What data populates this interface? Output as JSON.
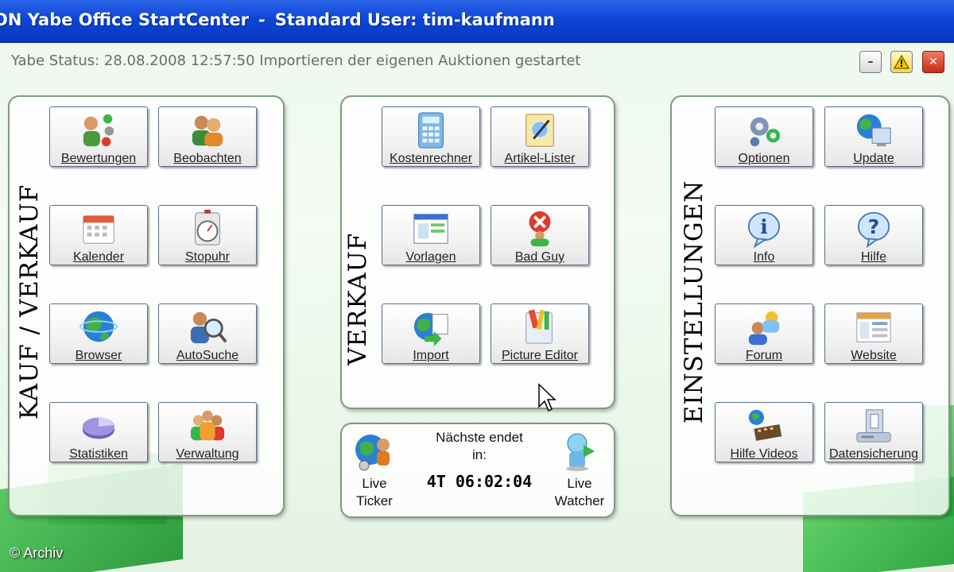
{
  "window": {
    "title_app": "ON Yabe Office StartCenter",
    "title_separator": "-",
    "title_user": "Standard User: tim-kaufmann",
    "status": "Yabe Status: 28.08.2008 12:57:50 Importieren der eigenen Auktionen gestartet",
    "buttons": {
      "minimize": "–",
      "warning": "!",
      "close": "✕"
    }
  },
  "panels": {
    "kauf": {
      "title": "KAUF / VERKAUF",
      "tiles": [
        {
          "label": "Bewertungen",
          "icon": "users-rating-icon"
        },
        {
          "label": "Beobachten",
          "icon": "watch-users-icon"
        },
        {
          "label": "Kalender",
          "icon": "calendar-icon"
        },
        {
          "label": "Stopuhr",
          "icon": "stopwatch-icon"
        },
        {
          "label": "Browser",
          "icon": "globe-icon"
        },
        {
          "label": "AutoSuche",
          "icon": "user-search-icon"
        },
        {
          "label": "Statistiken",
          "icon": "pie-chart-icon"
        },
        {
          "label": "Verwaltung",
          "icon": "group-icon"
        }
      ]
    },
    "verkauf": {
      "title": "VERKAUF",
      "tiles": [
        {
          "label": "Kostenrechner",
          "icon": "calculator-icon"
        },
        {
          "label": "Artikel-Lister",
          "icon": "article-list-icon"
        },
        {
          "label": "Vorlagen",
          "icon": "template-icon"
        },
        {
          "label": "Bad Guy",
          "icon": "bad-user-icon"
        },
        {
          "label": "Import",
          "icon": "import-icon"
        },
        {
          "label": "Picture Editor",
          "icon": "picture-editor-icon"
        }
      ]
    },
    "ticker": {
      "live_ticker": [
        "Live",
        "Ticker"
      ],
      "live_watcher": [
        "Live",
        "Watcher"
      ],
      "next_ends_line1": "Nächste endet",
      "next_ends_line2": "in:",
      "countdown": "4T  06:02:04"
    },
    "einstellungen": {
      "title": "EINSTELLUNGEN",
      "tiles": [
        {
          "label": "Optionen",
          "icon": "gears-icon"
        },
        {
          "label": "Update",
          "icon": "update-globe-icon"
        },
        {
          "label": "Info",
          "icon": "info-icon"
        },
        {
          "label": "Hilfe",
          "icon": "help-icon"
        },
        {
          "label": "Forum",
          "icon": "forum-icon"
        },
        {
          "label": "Website",
          "icon": "website-icon"
        },
        {
          "label": "Hilfe Videos",
          "icon": "film-icon"
        },
        {
          "label": "Datensicherung",
          "icon": "backup-icon"
        }
      ]
    }
  },
  "footer": {
    "copyright": "© Archiv"
  },
  "colors": {
    "titlebar": "#0d47d6",
    "panel_border": "#7f9a80",
    "background": "#eef8ee"
  }
}
